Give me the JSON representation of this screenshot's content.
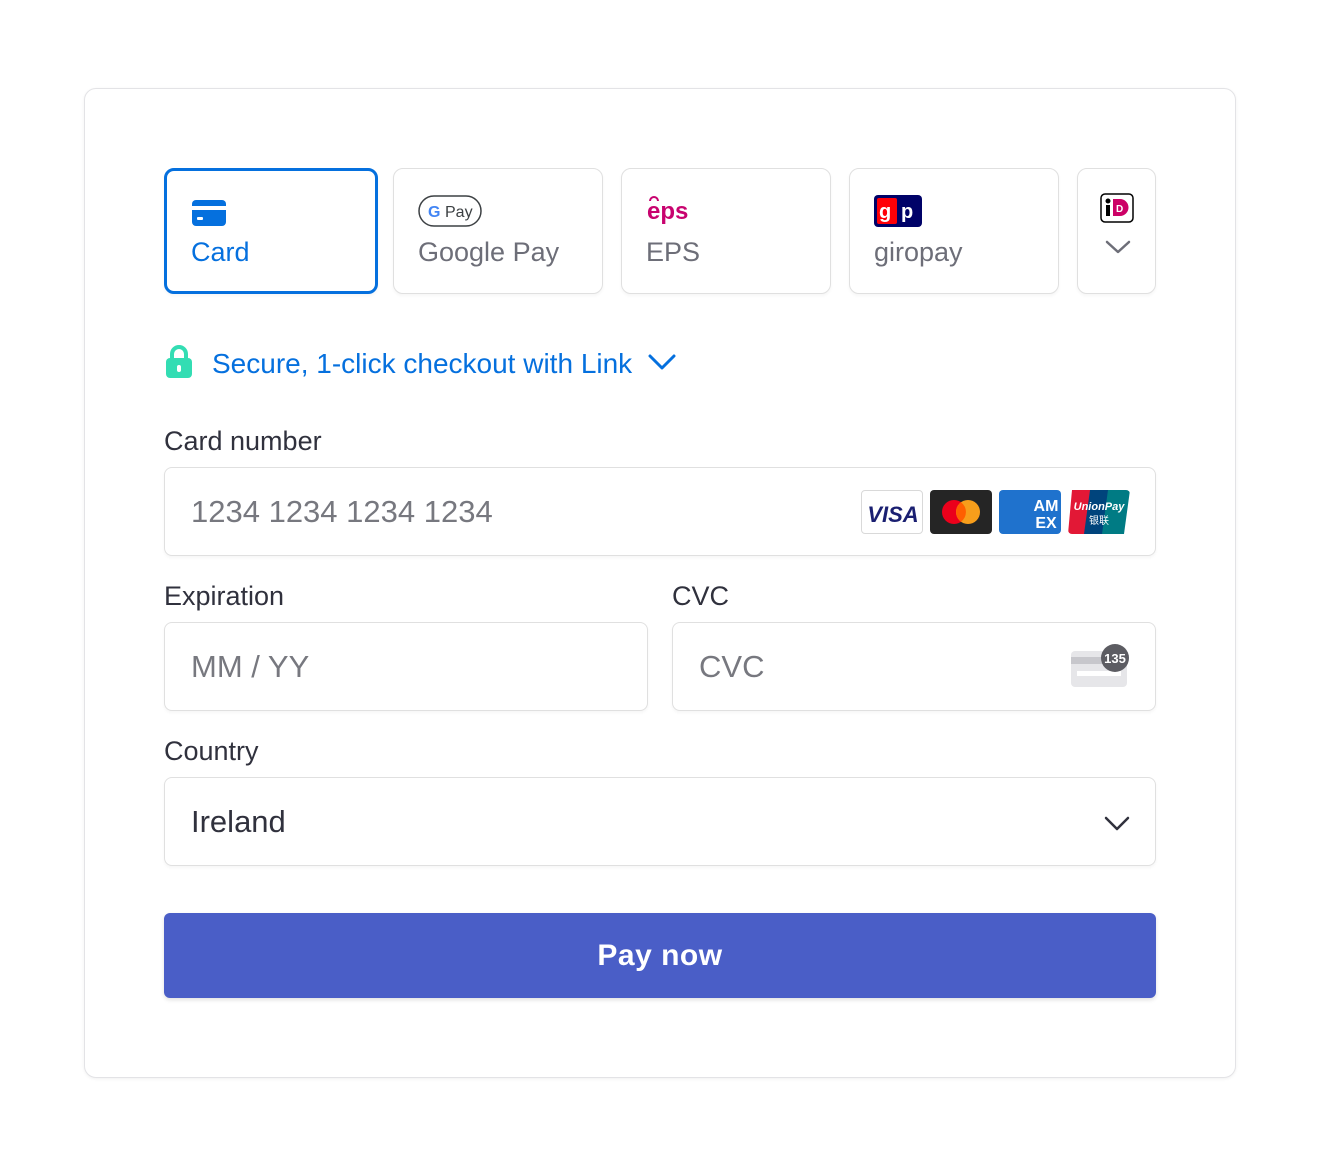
{
  "tabs": [
    {
      "label": "Card",
      "icon": "card-icon",
      "active": true
    },
    {
      "label": "Google Pay",
      "icon": "google-pay-icon",
      "badge_text": "Pay"
    },
    {
      "label": "EPS",
      "icon": "eps-icon",
      "badge_text": "eps"
    },
    {
      "label": "giropay",
      "icon": "giropay-icon",
      "badge_text": "gp"
    },
    {
      "label": "",
      "icon": "ideal-icon",
      "badge_text": "iD",
      "more_icon": "chevron-down-icon"
    }
  ],
  "link": {
    "text": "Secure, 1-click checkout with Link",
    "icon": "lock-icon",
    "color": "#0570de",
    "lock_color": "#33ddb3"
  },
  "card_number": {
    "label": "Card number",
    "placeholder": "1234 1234 1234 1234",
    "brands": [
      {
        "name": "visa-logo",
        "text": "VISA"
      },
      {
        "name": "mastercard-logo",
        "text": ""
      },
      {
        "name": "amex-logo",
        "text": "AM EX"
      },
      {
        "name": "unionpay-logo",
        "text": "UnionPay 银联"
      }
    ]
  },
  "expiration": {
    "label": "Expiration",
    "placeholder": "MM / YY"
  },
  "cvc": {
    "label": "CVC",
    "placeholder": "CVC",
    "badge": "135"
  },
  "country": {
    "label": "Country",
    "value": "Ireland"
  },
  "pay_button": {
    "label": "Pay now",
    "color": "#4a5ec7"
  },
  "colors": {
    "accent": "#0570de",
    "border": "#e0e0e0",
    "text": "#30313d",
    "placeholder": "#77787f"
  }
}
